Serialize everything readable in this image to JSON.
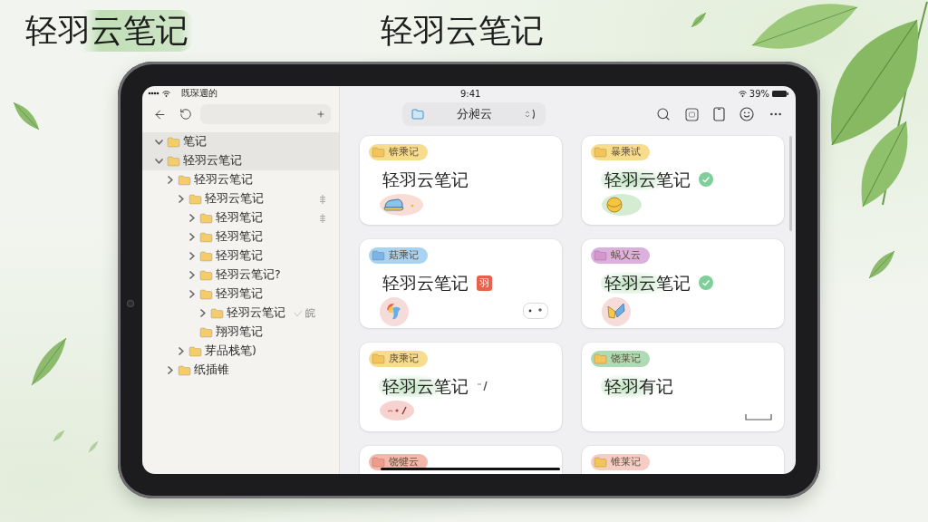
{
  "headings": [
    {
      "text": "轻羽云笔记",
      "highlighted": true
    },
    {
      "text": "轻羽云笔记",
      "highlighted": false
    }
  ],
  "status_bar": {
    "carrier": "既琛週的",
    "time": "9:41",
    "battery": "39%"
  },
  "sidebar": {
    "tree": [
      {
        "label": "笔记",
        "selected": true,
        "expandable": true,
        "expanded": true,
        "marker": false
      },
      {
        "label": "轻羽云笔记",
        "selected": true,
        "expandable": true,
        "expanded": true,
        "marker": false,
        "children": [
          {
            "label": "轻羽云笔记",
            "selected": false,
            "expandable": true,
            "expanded": false,
            "marker": false,
            "children": [
              {
                "label": "轻羽云笔记",
                "selected": false,
                "expandable": true,
                "expanded": false,
                "marker": true,
                "children": [
                  {
                    "label": "轻羽笔记",
                    "selected": false,
                    "expandable": true,
                    "expanded": false,
                    "marker": true
                  },
                  {
                    "label": "轻羽笔记",
                    "selected": false,
                    "expandable": true,
                    "expanded": false,
                    "marker": false
                  },
                  {
                    "label": "轻羽笔记",
                    "selected": false,
                    "expandable": true,
                    "expanded": false,
                    "marker": false
                  },
                  {
                    "label": "轻羽云笔记?",
                    "selected": false,
                    "expandable": true,
                    "expanded": false,
                    "marker": false
                  },
                  {
                    "label": "轻羽笔记",
                    "selected": false,
                    "expandable": true,
                    "expanded": false,
                    "marker": false,
                    "children": [
                      {
                        "label": "轻羽云笔记",
                        "selected": false,
                        "expandable": true,
                        "expanded": false,
                        "marker": false,
                        "note": "皖"
                      }
                    ]
                  },
                  {
                    "label": "翔羽笔记",
                    "selected": false,
                    "expandable": false,
                    "marker": false
                  }
                ]
              },
              {
                "label": "芽品栈笔)",
                "selected": false,
                "expandable": true,
                "expanded": false,
                "marker": false
              }
            ]
          },
          {
            "label": "纸插锥",
            "selected": false,
            "expandable": true,
            "expanded": false,
            "marker": false
          }
        ]
      }
    ]
  },
  "toolbar": {
    "folder_title": "分昶云"
  },
  "notes": [
    {
      "tag": {
        "label": "锛乘记",
        "color": "#f8dc8e",
        "folder": {
          "color": "#f2c45a"
        }
      },
      "title": "轻羽云笔记",
      "highlighted": false,
      "sticker": {
        "kind": "shoe",
        "color": "#f8ddd4"
      }
    },
    {
      "tag": {
        "label": "暴乘试",
        "color": "#f8dc8e",
        "folder": {
          "color": "#f2c45a"
        }
      },
      "title": "轻羽云笔记",
      "highlighted": true,
      "title_mark": {
        "kind": "check"
      },
      "sticker": {
        "kind": "ball",
        "color": "#d4ecd2"
      }
    },
    {
      "tag": {
        "label": "菇乘记",
        "color": "#a9d3f2",
        "folder": {
          "color": "#7db4e6"
        }
      },
      "title": "轻羽云笔记",
      "highlighted": false,
      "title_mark": {
        "kind": "seal",
        "text": "羽"
      },
      "sticker": {
        "kind": "bird",
        "color": "#f5dcd8"
      },
      "corner": {
        "kind": "toggle"
      }
    },
    {
      "tag": {
        "label": "蜗乂云",
        "color": "#dcb0dc",
        "folder": {
          "color": "#d596cf"
        }
      },
      "title": "轻羽云笔记",
      "highlighted": true,
      "title_mark": {
        "kind": "check"
      },
      "sticker": {
        "kind": "butterfly",
        "color": "#f5dcd8"
      }
    },
    {
      "tag": {
        "label": "庚乘记",
        "color": "#f8dc8e",
        "folder": {
          "color": "#f2c45a"
        }
      },
      "title": "轻羽云笔记",
      "highlighted": true,
      "title_mark": {
        "kind": "stroke"
      },
      "sticker": {
        "kind": "scribble",
        "color": "#f7d3d0"
      }
    },
    {
      "tag": {
        "label": "饶莱记",
        "color": "#aedbb4",
        "folder": {
          "color": "#f2c45a"
        }
      },
      "title": "轻羽有记",
      "highlighted": true,
      "corner": {
        "kind": "bracket"
      }
    },
    {
      "tag": {
        "label": "饶犍云",
        "color": "#f4b7aa",
        "folder": {
          "color": "#ee9d8a"
        }
      }
    },
    {
      "tag": {
        "label": "锥莱记",
        "color": "#f6cdc4",
        "folder": {
          "color": "#f2c45a"
        }
      }
    }
  ]
}
